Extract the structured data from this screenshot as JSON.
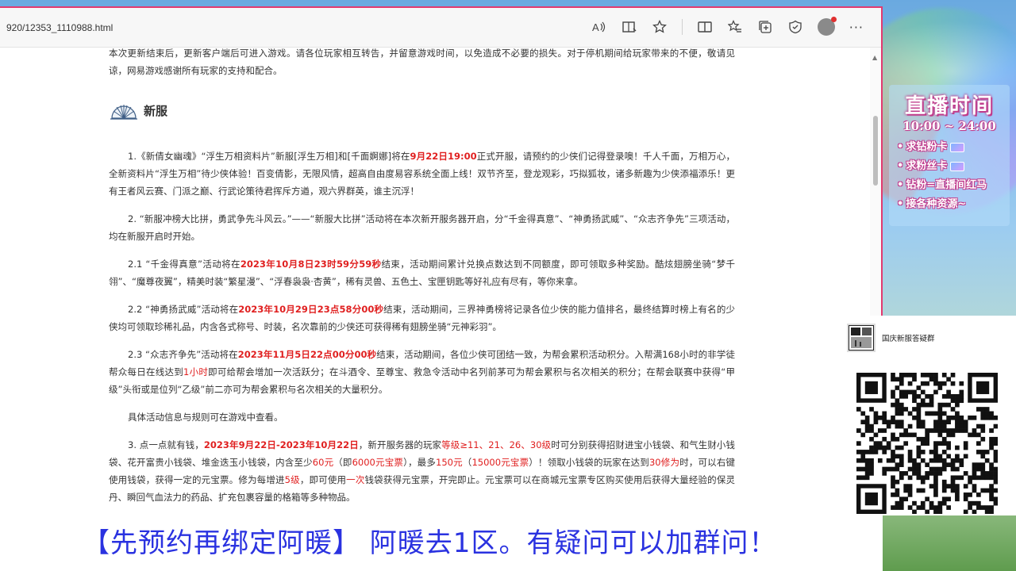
{
  "browser": {
    "url": "920/12353_1110988.html",
    "toolbar_icons": [
      "read-aloud-icon",
      "immersive-reader-icon",
      "favorite-star-icon",
      "split-screen-icon",
      "favorites-icon",
      "collections-icon",
      "browser-essentials-icon",
      "profile-avatar",
      "more-icon"
    ]
  },
  "article": {
    "intro": "本次更新结束后，更新客户端后可进入游戏。请各位玩家相互转告，并留意游戏时间，以免造成不必要的损失。对于停机期间给玩家带来的不便，敬请见谅，网易游戏感谢所有玩家的支持和配合。",
    "section_title": "新服",
    "p1_a": "1.《新倩女幽魂》“浮生万相资料片”新服[浮生万相]和[千面婀娜]将在",
    "p1_red": "9月22日19:00",
    "p1_b": "正式开服，请预约的少侠们记得登录噢！千人千面，万相万心，全新资料片“浮生万相”待少侠体验！百变倩影，无限风情，超高自由度易容系统全面上线！双节齐至，登龙观彩，巧拟狐妆，诸多新趣为少侠添福添乐！更有王者风云赛、门派之巅、行武论策待君挥斥方遒，观六界群英，谁主沉浮！",
    "p2": "2. “新服冲榜大比拼，勇武争先斗风云。”——“新服大比拼”活动将在本次新开服务器开启，分“千金得真意”、“神勇扬武威”、“众志齐争先”三项活动，均在新服开启时开始。",
    "p21_a": "2.1 “千金得真意”活动将在",
    "p21_red": "2023年10月8日23时59分59秒",
    "p21_b": "结束，活动期间累计兑换点数达到不同额度，即可领取多种奖励。酷炫翅膀坐骑“梦千翎”、“魔尊夜翼”，精美时装“繁星漫”、“浮春袅袅·杏黄”，稀有灵兽、五色土、宝匣钥匙等好礼应有尽有，等你来拿。",
    "p22_a": "2.2 “神勇扬武威”活动将在",
    "p22_red": "2023年10月29日23点58分00秒",
    "p22_b": "结束，活动期间，三界神勇榜将记录各位少侠的能力值排名，最终结算时榜上有名的少侠均可领取珍稀礼品，内含各式称号、时装，名次靠前的少侠还可获得稀有翅膀坐骑“元神彩羽”。",
    "p23_a": "2.3 “众志齐争先”活动将在",
    "p23_red": "2023年11月5日22点00分00秒",
    "p23_b": "结束，活动期间，各位少侠可团结一致，为帮会累积活动积分。入帮满168小时的非学徒帮众每日在线达到",
    "p23_red2": "1小时",
    "p23_c": "即可给帮会增加一次活跃分；在斗酒令、至尊宝、救急令活动中名列前茅可为帮会累积与名次相关的积分；在帮会联赛中获得“甲级”头衔或是位列“乙级”前二亦可为帮会累积与名次相关的大量积分。",
    "p_info": "具体活动信息与规则可在游戏中查看。",
    "p3_a": "3. 点一点就有钱，",
    "p3_red": "2023年9月22日-2023年10月22日",
    "p3_b": "，新开服务器的玩家",
    "p3_red2": "等级≥11、21、26、30级",
    "p3_c": "时可分别获得招财进宝小钱袋、和气生财小钱袋、花开富贵小钱袋、堆金迭玉小钱袋，内含至少",
    "p3_red3": "60元",
    "p3_d": "（即",
    "p3_red4": "6000元宝票",
    "p3_e": "），最多",
    "p3_red5": "150元",
    "p3_f": "（",
    "p3_red6": "15000元宝票",
    "p3_g": "）！领取小钱袋的玩家在达到",
    "p3_red7": "30修为",
    "p3_h": "时，可以右键使用钱袋，获得一定的元宝票。修为每增进",
    "p3_red8": "5级",
    "p3_i": "，即可使用",
    "p3_red9": "一次",
    "p3_j": "钱袋获得元宝票，开完即止。元宝票可以在商城元宝票专区购买使用后获得大量经验的保灵丹、瞬回气血法力的药品、扩充包裹容量的格箱等多种物品。"
  },
  "live_panel": {
    "title": "直播时间",
    "time": "10:00 ~ 24:00",
    "items": [
      "求钻粉卡",
      "求粉丝卡",
      "钻粉=直播间红马",
      "接各种资源~"
    ]
  },
  "qr_card": {
    "group_name": "国庆新服答疑群"
  },
  "banner": {
    "text": "【先预约再绑定阿暖】 阿暖去1区。有疑问可以加群问！"
  },
  "colors": {
    "accent_red": "#e02020",
    "banner_blue": "#2a32e0",
    "window_border": "#e23a6f"
  }
}
